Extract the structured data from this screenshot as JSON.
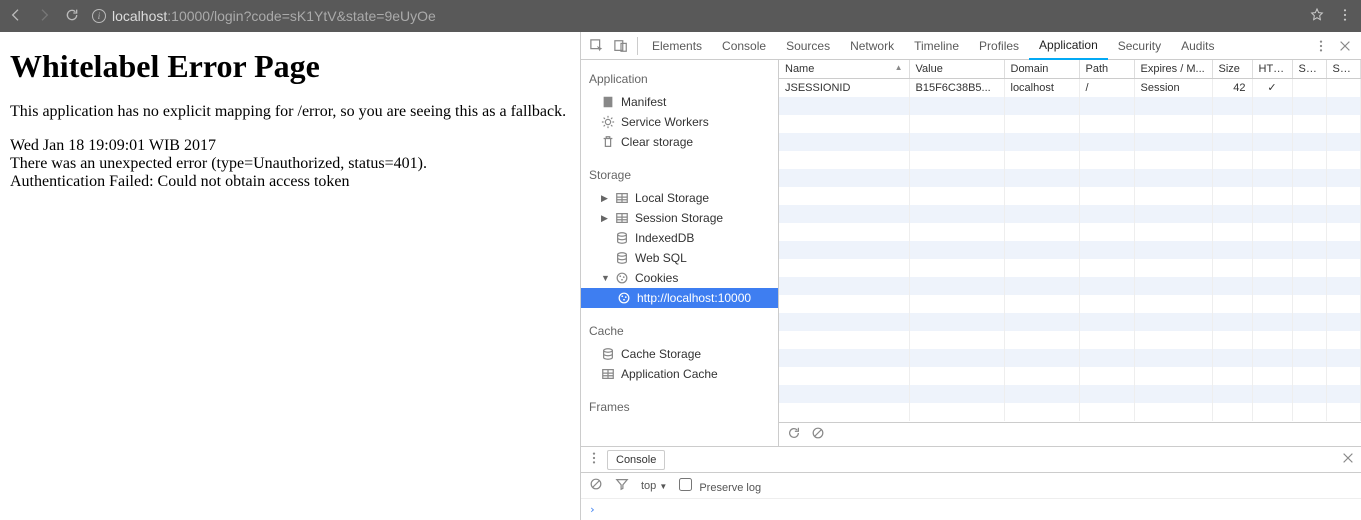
{
  "browser": {
    "url_host": "localhost",
    "url_port": ":10000",
    "url_path": "/login?code=sK1YtV&state=9eUyOe"
  },
  "page": {
    "title": "Whitelabel Error Page",
    "fallback_msg": "This application has no explicit mapping for /error, so you are seeing this as a fallback.",
    "timestamp": "Wed Jan 18 19:09:01 WIB 2017",
    "error_line": "There was an unexpected error (type=Unauthorized, status=401).",
    "auth_line": "Authentication Failed: Could not obtain access token"
  },
  "devtools": {
    "tabs": [
      "Elements",
      "Console",
      "Sources",
      "Network",
      "Timeline",
      "Profiles",
      "Application",
      "Security",
      "Audits"
    ],
    "active_tab": "Application",
    "sidebar": {
      "application": {
        "title": "Application",
        "items": [
          "Manifest",
          "Service Workers",
          "Clear storage"
        ]
      },
      "storage": {
        "title": "Storage",
        "items": [
          {
            "label": "Local Storage",
            "expandable": true,
            "expanded": false
          },
          {
            "label": "Session Storage",
            "expandable": true,
            "expanded": false
          },
          {
            "label": "IndexedDB",
            "expandable": false
          },
          {
            "label": "Web SQL",
            "expandable": false
          },
          {
            "label": "Cookies",
            "expandable": true,
            "expanded": true,
            "children": [
              {
                "label": "http://localhost:10000",
                "selected": true
              }
            ]
          }
        ]
      },
      "cache": {
        "title": "Cache",
        "items": [
          "Cache Storage",
          "Application Cache"
        ]
      },
      "frames": {
        "title": "Frames"
      }
    },
    "cookie_table": {
      "columns": [
        "Name",
        "Value",
        "Domain",
        "Path",
        "Expires / M...",
        "Size",
        "HTTP",
        "Se...",
        "Sa..."
      ],
      "rows": [
        {
          "name": "JSESSIONID",
          "value": "B15F6C38B5...",
          "domain": "localhost",
          "path": "/",
          "expires": "Session",
          "size": "42",
          "http": "✓",
          "secure": "",
          "same": ""
        }
      ]
    },
    "console_drawer": {
      "tab_label": "Console",
      "context": "top",
      "preserve_log_label": "Preserve log",
      "prompt": "›"
    }
  }
}
